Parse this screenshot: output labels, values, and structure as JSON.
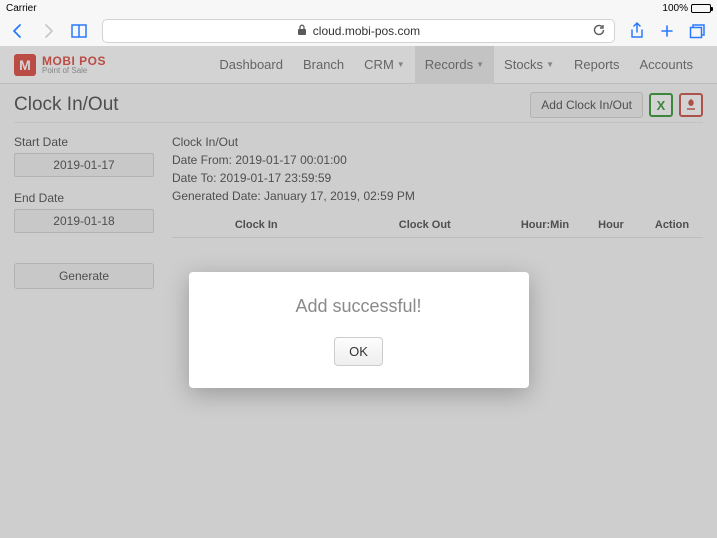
{
  "statusbar": {
    "carrier": "Carrier",
    "battery": "100%"
  },
  "browser": {
    "url": "cloud.mobi-pos.com"
  },
  "logo": {
    "line1": "MOBI POS",
    "line2": "Point of Sale",
    "badge": "M"
  },
  "nav": {
    "dashboard": "Dashboard",
    "branch": "Branch",
    "crm": "CRM",
    "records": "Records",
    "stocks": "Stocks",
    "reports": "Reports",
    "accounts": "Accounts"
  },
  "page": {
    "title": "Clock In/Out",
    "add_btn": "Add Clock In/Out"
  },
  "filter": {
    "start_label": "Start Date",
    "start_value": "2019-01-17",
    "end_label": "End Date",
    "end_value": "2019-01-18",
    "generate": "Generate"
  },
  "report": {
    "heading": "Clock In/Out",
    "date_from": "Date From: 2019-01-17 00:01:00",
    "date_to": "Date To: 2019-01-17 23:59:59",
    "generated": "Generated Date: January 17, 2019, 02:59 PM",
    "cols": {
      "clockin": "Clock In",
      "clockout": "Clock Out",
      "hourmin": "Hour:Min",
      "hour": "Hour",
      "action": "Action"
    }
  },
  "modal": {
    "message": "Add successful!",
    "ok": "OK"
  }
}
